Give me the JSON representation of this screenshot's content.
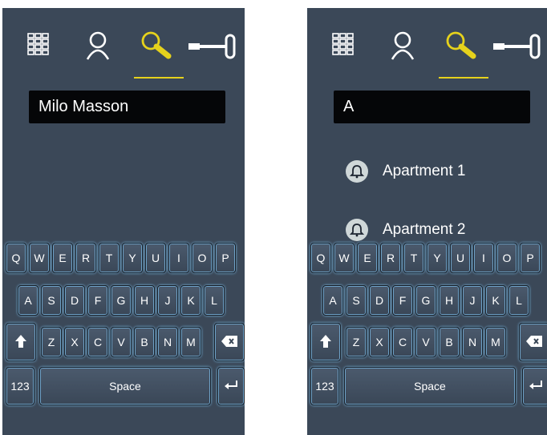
{
  "left_screen": {
    "search_value": "Milo Masson",
    "results": []
  },
  "right_screen": {
    "search_value": "A",
    "results": [
      {
        "label": "Apartment 1",
        "icon": "bell-icon"
      },
      {
        "label": "Apartment 2",
        "icon": "bell-icon"
      }
    ]
  },
  "toolbar": {
    "tabs": [
      {
        "name": "keypad",
        "icon": "keypad-grid-icon"
      },
      {
        "name": "contacts",
        "icon": "person-icon"
      },
      {
        "name": "search",
        "icon": "search-icon",
        "active": true
      },
      {
        "name": "access",
        "icon": "key-icon"
      }
    ]
  },
  "keyboard": {
    "row1": [
      "Q",
      "W",
      "E",
      "R",
      "T",
      "Y",
      "U",
      "I",
      "O",
      "P"
    ],
    "row2": [
      "A",
      "S",
      "D",
      "F",
      "G",
      "H",
      "J",
      "K",
      "L"
    ],
    "row3": [
      "Z",
      "X",
      "C",
      "V",
      "B",
      "N",
      "M"
    ],
    "shift_icon": "shift-up-arrow-icon",
    "backspace_icon": "backspace-icon",
    "numbers_label": "123",
    "space_label": "Space",
    "enter_icon": "enter-return-icon"
  },
  "colors": {
    "background": "#3b4858",
    "accent": "#e6d21c",
    "key_glow": "#7fc0ec",
    "search_field": "#050608"
  }
}
